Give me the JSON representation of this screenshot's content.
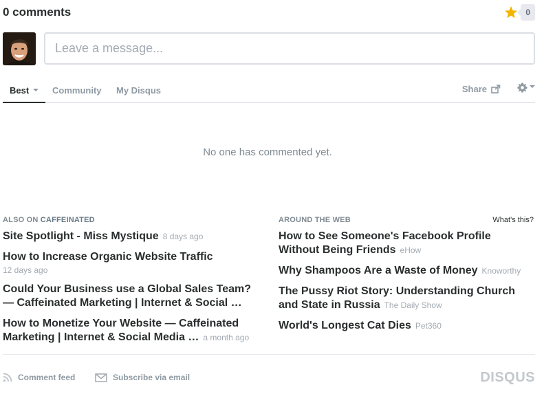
{
  "header": {
    "comment_count": "0 comments",
    "star_count": "0"
  },
  "composer": {
    "placeholder": "Leave a message..."
  },
  "tabs": [
    {
      "label": "Best",
      "active": true
    },
    {
      "label": "Community",
      "active": false
    },
    {
      "label": "My Disqus",
      "active": false
    }
  ],
  "toolbar": {
    "share_label": "Share"
  },
  "empty_state": "No one has commented yet.",
  "also_on": {
    "label_prefix": "ALSO ON ",
    "site_name": "CAFFEINATED",
    "items": [
      {
        "title": "Site Spotlight - Miss Mystique",
        "meta": "8 days ago"
      },
      {
        "title": "How to Increase Organic Website Traffic",
        "meta": "12 days ago"
      },
      {
        "title": "Could Your Business use a Global Sales Team? — Caffeinated Marketing | Internet & Social …",
        "meta": ""
      },
      {
        "title": "How to Monetize Your Website — Caffeinated Marketing | Internet & Social Media …",
        "meta": "a month ago"
      }
    ]
  },
  "around_web": {
    "label": "AROUND THE WEB",
    "whats_this": "What's this?",
    "items": [
      {
        "title": "How to See Someone's Facebook Profile Without Being Friends",
        "meta": "eHow"
      },
      {
        "title": "Why Shampoos Are a Waste of Money",
        "meta": "Knoworthy"
      },
      {
        "title": "The Pussy Riot Story: Understanding Church and State in Russia",
        "meta": "The Daily Show"
      },
      {
        "title": "World's Longest Cat Dies",
        "meta": "Pet360"
      }
    ]
  },
  "footer": {
    "comment_feed": "Comment feed",
    "subscribe": "Subscribe via email",
    "brand": "DISQUS"
  },
  "colors": {
    "star": "#f4b400",
    "text": "#2a2e2e",
    "muted": "#8f9aa3",
    "light": "#a3aab1"
  }
}
